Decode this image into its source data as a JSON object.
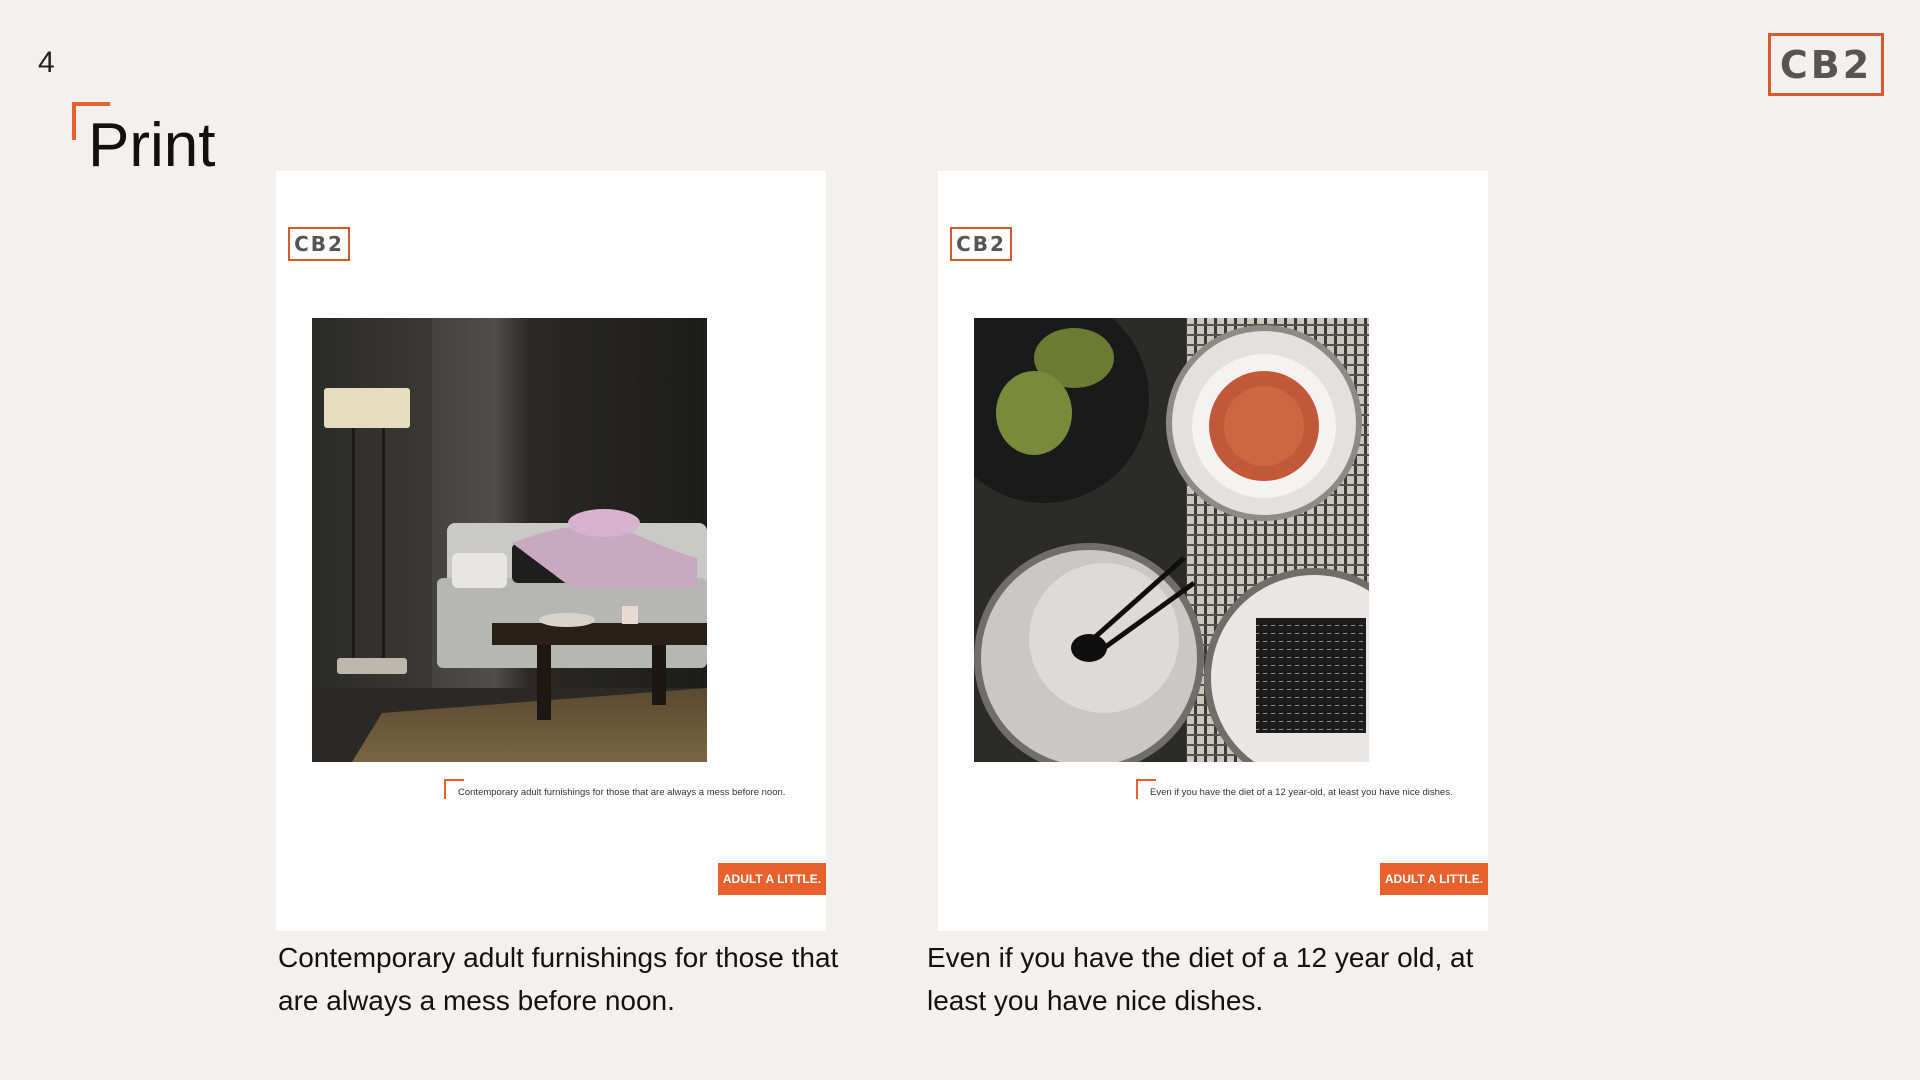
{
  "page": {
    "number": "4",
    "title": "Print"
  },
  "brand": {
    "logo": "CB2",
    "accent": "#e8602c"
  },
  "ads": [
    {
      "logo": "CB2",
      "photo": "living-room-photo",
      "caption": "Contemporary adult furnishings for those that are always a mess before noon.",
      "button": "ADULT A LITTLE."
    },
    {
      "logo": "CB2",
      "photo": "dishes-photo",
      "caption": "Even if you have the diet of a 12 year-old, at least you have nice dishes.",
      "button": "ADULT A LITTLE."
    }
  ],
  "descriptions": [
    "Contemporary adult furnishings for those that are always a mess before noon.",
    "Even if you have the diet of a 12 year old, at least you have nice dishes."
  ]
}
